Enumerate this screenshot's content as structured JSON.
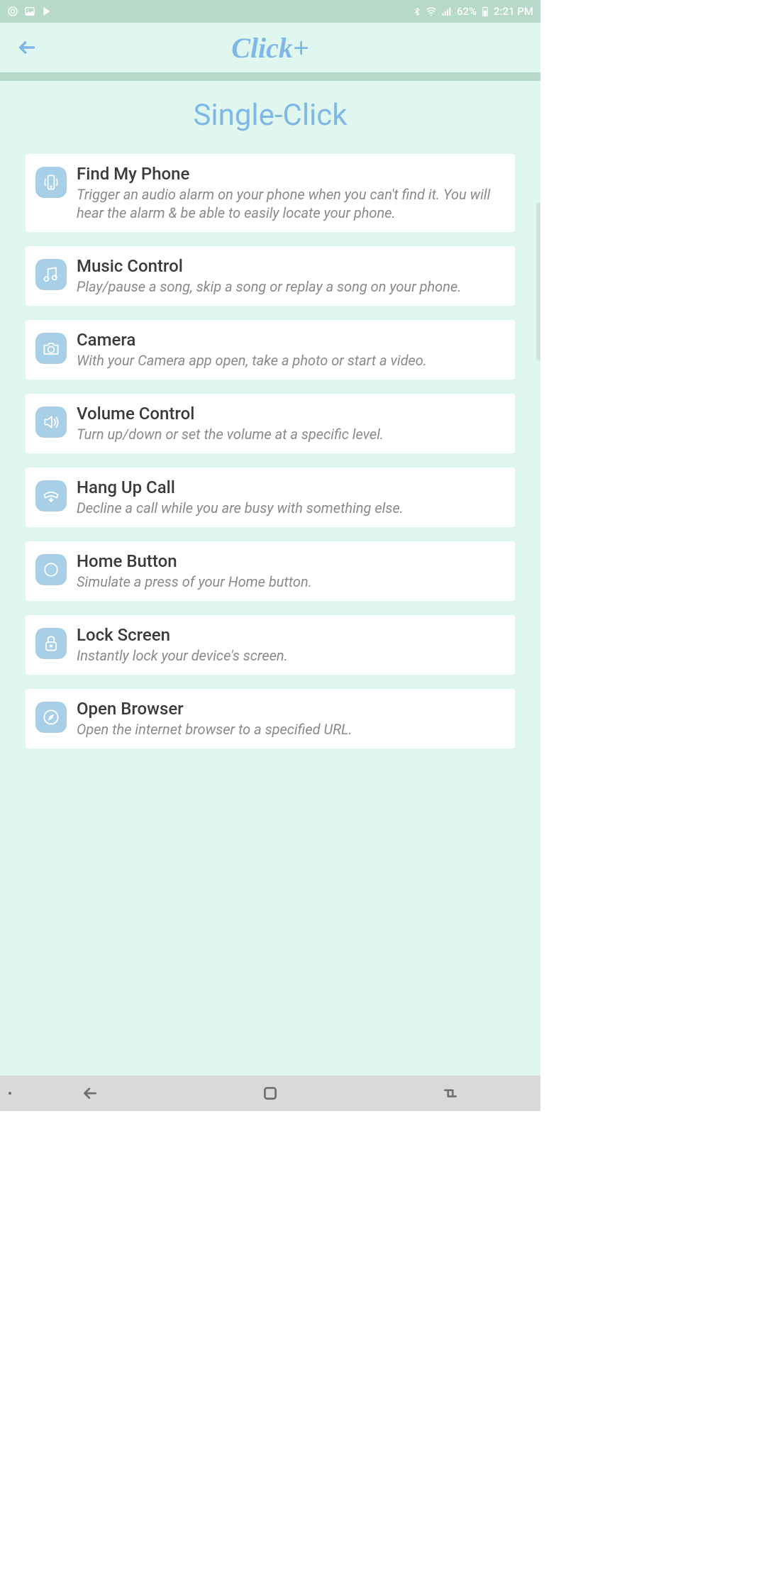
{
  "status_bar": {
    "battery_pct": "62%",
    "time": "2:21 PM"
  },
  "header": {
    "app_name": "Click+"
  },
  "page": {
    "title": "Single-Click"
  },
  "actions": [
    {
      "icon": "phone-ring-icon",
      "title": "Find My Phone",
      "desc": "Trigger an audio alarm on your phone when you can't find it. You will hear the alarm & be able to easily locate your phone."
    },
    {
      "icon": "music-note-icon",
      "title": "Music Control",
      "desc": "Play/pause a song, skip a song or replay a song on your phone."
    },
    {
      "icon": "camera-icon",
      "title": "Camera",
      "desc": "With your Camera app open, take a photo or start a video."
    },
    {
      "icon": "speaker-icon",
      "title": "Volume Control",
      "desc": "Turn up/down or set the volume at a specific level."
    },
    {
      "icon": "phone-hangup-icon",
      "title": "Hang Up Call",
      "desc": "Decline a call while you are busy with something else."
    },
    {
      "icon": "circle-icon",
      "title": "Home Button",
      "desc": "Simulate a press of your Home button."
    },
    {
      "icon": "lock-icon",
      "title": "Lock Screen",
      "desc": "Instantly lock your device's screen."
    },
    {
      "icon": "compass-icon",
      "title": "Open Browser",
      "desc": "Open the internet browser to a specified URL."
    }
  ]
}
